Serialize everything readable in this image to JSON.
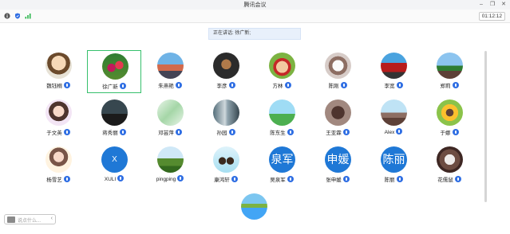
{
  "window": {
    "title": "腾讯会议"
  },
  "toolbar": {
    "timer": "01:12:12",
    "signal_color": "#28b54a",
    "shield_color": "#2f6ee3"
  },
  "speaking": {
    "label": "正在讲话: 徐广新;"
  },
  "participants": [
    {
      "name": "魏钰桐",
      "avatar": "photo-cartoon"
    },
    {
      "name": "徐广新",
      "avatar": "photo-flowers",
      "active": true
    },
    {
      "name": "朱燕艳",
      "avatar": "photo-city"
    },
    {
      "name": "李彦",
      "avatar": "photo-dark"
    },
    {
      "name": "方林",
      "avatar": "photo-cartoon-green"
    },
    {
      "name": "陈刚",
      "avatar": "photo-cat"
    },
    {
      "name": "李宽",
      "avatar": "photo-building"
    },
    {
      "name": "郑莉",
      "avatar": "photo-palace"
    },
    {
      "name": "于文英",
      "avatar": "photo-girl"
    },
    {
      "name": "蒋秀丽",
      "avatar": "photo-dark-city"
    },
    {
      "name": "邓芸萍",
      "avatar": "photo-leaves"
    },
    {
      "name": "孙园",
      "avatar": "photo-waterfall"
    },
    {
      "name": "陈东生",
      "avatar": "photo-sky"
    },
    {
      "name": "王亚霖",
      "avatar": "photo-dog"
    },
    {
      "name": "Alex",
      "avatar": "photo-mountain"
    },
    {
      "name": "于娜",
      "avatar": "photo-sunflower"
    },
    {
      "name": "杨雪艺",
      "avatar": "photo-girl2"
    },
    {
      "name": "XULI",
      "avatar_text": "X"
    },
    {
      "name": "pingping",
      "avatar": "photo-hill"
    },
    {
      "name": "康鸿轩",
      "avatar": "photo-couple"
    },
    {
      "name": "吴泉军",
      "avatar_text": "泉军"
    },
    {
      "name": "张申媛",
      "avatar_text": "申媛"
    },
    {
      "name": "陈丽",
      "avatar_text": "陈丽"
    },
    {
      "name": "花儒鼠",
      "avatar": "photo-pet"
    },
    {
      "name": "",
      "avatar": "photo-lake"
    }
  ],
  "chat": {
    "placeholder": "说点什么..."
  }
}
